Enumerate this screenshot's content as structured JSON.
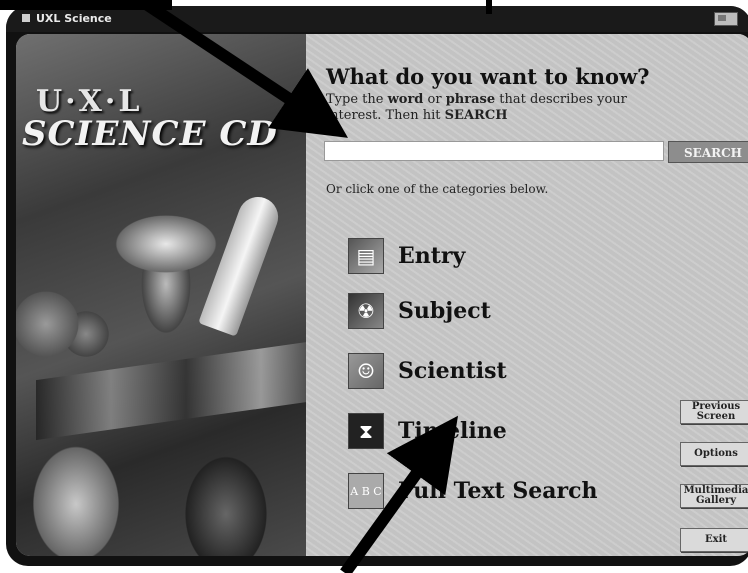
{
  "window": {
    "title": "UXL Science"
  },
  "logo": {
    "brand_top": "U·X·L",
    "brand_main": "SCIENCE CD"
  },
  "search": {
    "heading": "What do you want to know?",
    "instruction_pre": "Type the ",
    "instruction_word": "word",
    "instruction_or": " or ",
    "instruction_phrase": "phrase",
    "instruction_mid": " that describes your interest. Then hit ",
    "instruction_search": "SEARCH",
    "input_value": "",
    "button_label": "SEARCH",
    "or_text": "Or click one of the categories below."
  },
  "categories": [
    {
      "label": "Entry",
      "icon": "book-icon"
    },
    {
      "label": "Subject",
      "icon": "atom-icon"
    },
    {
      "label": "Scientist",
      "icon": "portrait-icon"
    },
    {
      "label": "Timeline",
      "icon": "hourglass-icon"
    },
    {
      "label": "Full Text Search",
      "icon": "abc-icon",
      "glyph": "A B C"
    }
  ],
  "side_buttons": {
    "previous": "Previous Screen",
    "options": "Options",
    "multimedia": "Multimedia Gallery",
    "exit": "Exit"
  }
}
